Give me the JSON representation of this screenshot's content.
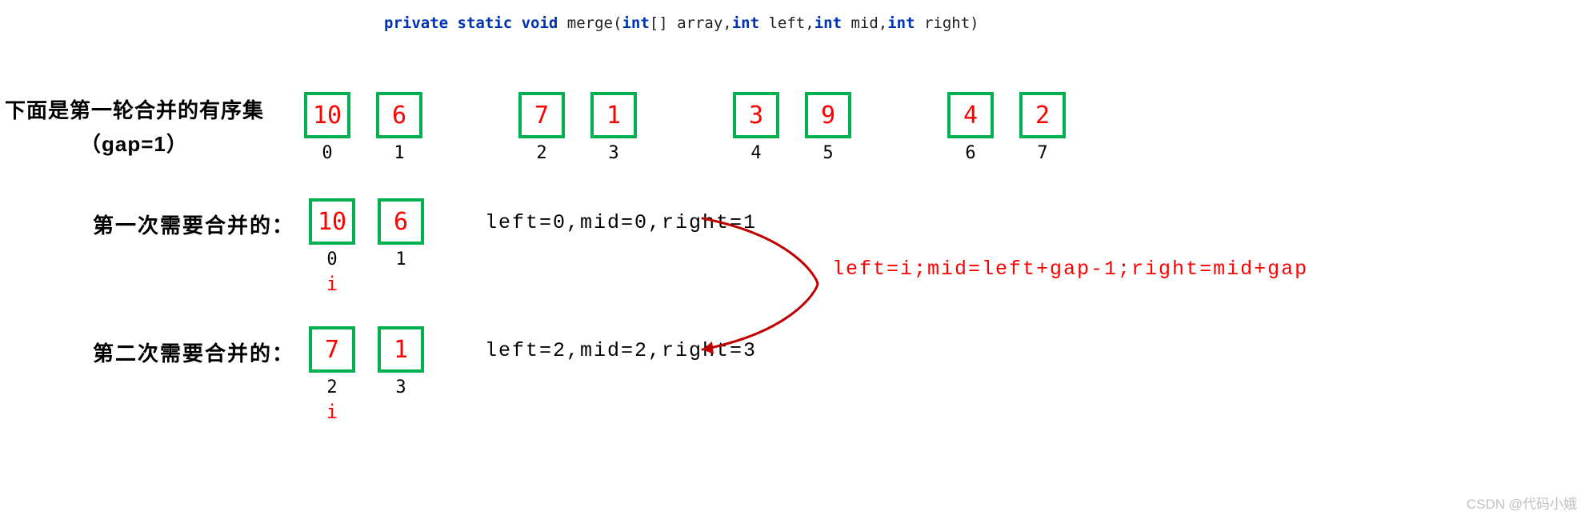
{
  "code": {
    "kw1": "private static void",
    "fn": " merge",
    "paren_open": "(",
    "kw2": "int",
    "p1": "[] array,",
    "kw3": "int",
    "p2": " left,",
    "kw4": "int",
    "p3": " mid,",
    "kw5": "int",
    "p4": " right)",
    "full": "private static void merge(int[] array,int left,int mid,int right)"
  },
  "caption": {
    "line1": "下面是第一轮合并的有序集",
    "line2": "（gap=1）"
  },
  "array": {
    "pairs": [
      [
        {
          "val": "10",
          "idx": "0"
        },
        {
          "val": "6",
          "idx": "1"
        }
      ],
      [
        {
          "val": "7",
          "idx": "2"
        },
        {
          "val": "1",
          "idx": "3"
        }
      ],
      [
        {
          "val": "3",
          "idx": "4"
        },
        {
          "val": "9",
          "idx": "5"
        }
      ],
      [
        {
          "val": "4",
          "idx": "6"
        },
        {
          "val": "2",
          "idx": "7"
        }
      ]
    ]
  },
  "merge1": {
    "label": "第一次需要合并的：",
    "boxes": [
      {
        "val": "10",
        "idx": "0",
        "i": "i"
      },
      {
        "val": "6",
        "idx": "1"
      }
    ],
    "info": "left=0,mid=0,right=1"
  },
  "merge2": {
    "label": "第二次需要合并的：",
    "boxes": [
      {
        "val": "7",
        "idx": "2",
        "i": "i"
      },
      {
        "val": "1",
        "idx": "3"
      }
    ],
    "info": "left=2,mid=2,right=3"
  },
  "formula": "left=i;mid=left+gap-1;right=mid+gap",
  "watermark": "CSDN @代码小娥",
  "colors": {
    "box_border": "#00b050",
    "value_text": "#ff0000",
    "curve": "#c00000",
    "keyword": "#0033b3"
  }
}
